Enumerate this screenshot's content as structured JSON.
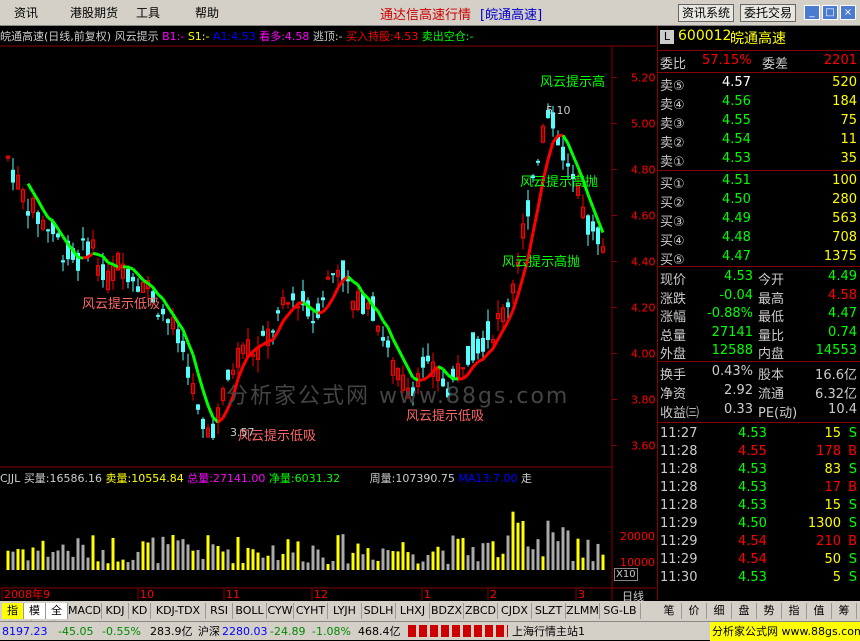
{
  "menu": {
    "items": [
      "资讯",
      "港股期货",
      "工具",
      "帮助"
    ],
    "title": "通达信高速行情",
    "subtitle": "[皖通高速]",
    "btn1": "资讯系统",
    "btn2": "委托交易"
  },
  "header": {
    "stock": "皖通高速(日线,前复权) 风云提示",
    "b1": "B1:-",
    "s1": "S1:-",
    "a1": "A1:4.53",
    "kanduo": "看多:4.58",
    "taoding": "逃顶:-",
    "mairu": "买入持股:4.53",
    "maichu": "卖出空仓:-"
  },
  "chart_data": {
    "type": "candlestick",
    "ylim": [
      3.55,
      5.25
    ],
    "yticks": [
      "5.20",
      "5.00",
      "4.80",
      "4.60",
      "4.40",
      "4.20",
      "4.00",
      "3.80",
      "3.60"
    ],
    "xticks": [
      "2008年9",
      "10",
      "11",
      "12",
      "1",
      "2",
      "3"
    ],
    "high_label": "5.10",
    "low_label": "3.57",
    "annotations": [
      "风云提示高",
      "风云提示高抛",
      "风云提示高抛",
      "风云提示低吸",
      "风云提示低吸",
      "风云提示低吸"
    ],
    "volume_yticks": [
      "20000",
      "10000"
    ],
    "multiplier": "X10"
  },
  "watermark": "分析家公式网 www.88gs.com",
  "vol": {
    "name": "CJJL",
    "maimai": "买量:16586.16",
    "maichu": "卖量:10554.84",
    "zong": "总量:27141.00",
    "jing": "净量:6031.32",
    "zhou": "周量:107390.75",
    "ma": "MA13:7.00",
    "zou": "走"
  },
  "period": "日线",
  "quote": {
    "code": "600012",
    "name": "皖通高速",
    "weibi_l": "委比",
    "weibi": "57.15%",
    "weicha_l": "委差",
    "weicha": "2201",
    "sell": [
      {
        "l": "卖⑤",
        "p": "4.57",
        "v": "520"
      },
      {
        "l": "卖④",
        "p": "4.56",
        "v": "184"
      },
      {
        "l": "卖③",
        "p": "4.55",
        "v": "75"
      },
      {
        "l": "卖②",
        "p": "4.54",
        "v": "11"
      },
      {
        "l": "卖①",
        "p": "4.53",
        "v": "35"
      }
    ],
    "buy": [
      {
        "l": "买①",
        "p": "4.51",
        "v": "100"
      },
      {
        "l": "买②",
        "p": "4.50",
        "v": "280"
      },
      {
        "l": "买③",
        "p": "4.49",
        "v": "563"
      },
      {
        "l": "买④",
        "p": "4.48",
        "v": "708"
      },
      {
        "l": "买⑤",
        "p": "4.47",
        "v": "1375"
      }
    ],
    "stats": [
      [
        "现价",
        "4.53",
        "今开",
        "4.49"
      ],
      [
        "涨跌",
        "-0.04",
        "最高",
        "4.58"
      ],
      [
        "涨幅",
        "-0.88%",
        "最低",
        "4.47"
      ],
      [
        "总量",
        "27141",
        "量比",
        "0.74"
      ],
      [
        "外盘",
        "12588",
        "内盘",
        "14553"
      ]
    ],
    "stats2": [
      [
        "换手",
        "0.43%",
        "股本",
        "16.6亿"
      ],
      [
        "净资",
        "2.92",
        "流通",
        "6.32亿"
      ],
      [
        "收益㈢",
        "0.33",
        "PE(动)",
        "10.4"
      ]
    ],
    "ticks": [
      [
        "11:27",
        "4.53",
        "15",
        "S"
      ],
      [
        "11:28",
        "4.55",
        "178",
        "B"
      ],
      [
        "11:28",
        "4.53",
        "83",
        "S"
      ],
      [
        "11:28",
        "4.53",
        "17",
        "B"
      ],
      [
        "11:28",
        "4.53",
        "15",
        "S"
      ],
      [
        "11:29",
        "4.50",
        "1300",
        "S"
      ],
      [
        "11:29",
        "4.54",
        "210",
        "B"
      ],
      [
        "11:29",
        "4.54",
        "50",
        "S"
      ],
      [
        "11:30",
        "4.53",
        "5",
        "S"
      ]
    ],
    "side_tabs": [
      "笔",
      "价",
      "细",
      "盘",
      "势",
      "指",
      "值",
      "筹"
    ]
  },
  "tabs": [
    "指标",
    "模板",
    "全部",
    "MACD",
    "KDJ",
    "KD",
    "KDJ-TDX",
    "RSI",
    "BOLL",
    "CYW",
    "CYHT",
    "LYJH",
    "SDLH",
    "LHXJ",
    "BDZX",
    "ZBCD",
    "CJDX",
    "SLZT",
    "ZLMM",
    "SG-LB"
  ],
  "status": {
    "sh": "8197.23",
    "shchg": "-45.05",
    "shpct": "-0.55%",
    "shamt": "283.9亿",
    "hs_l": "沪深",
    "hs": "2280.03",
    "hschg": "-24.89",
    "hspct": "-1.08%",
    "hsamt": "468.4亿",
    "station": "上海行情主站1",
    "site": "分析家公式网 www.88gs.com"
  }
}
